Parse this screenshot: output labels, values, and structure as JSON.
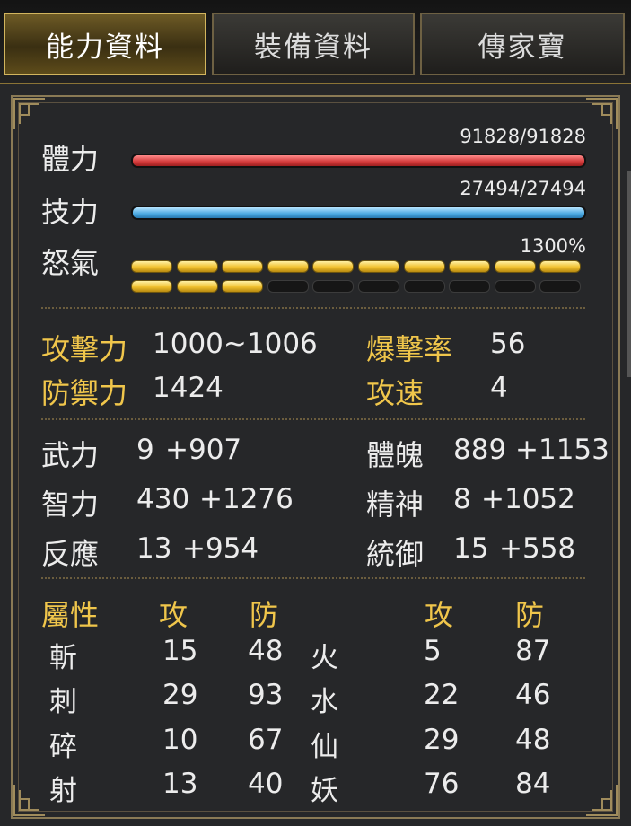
{
  "tabs": [
    "能力資料",
    "裝備資料",
    "傳家寶"
  ],
  "vitals": {
    "hp_label": "體力",
    "hp_value": "91828/91828",
    "hp_fraction": 1.0,
    "sp_label": "技力",
    "sp_value": "27494/27494",
    "sp_fraction": 1.0,
    "rage_label": "怒氣",
    "rage_value": "1300%",
    "rage_filled": 13,
    "rage_total": 20
  },
  "combat": {
    "attack_label": "攻擊力",
    "attack_value": "1000~1006",
    "crit_label": "爆擊率",
    "crit_value": "56",
    "defense_label": "防禦力",
    "defense_value": "1424",
    "speed_label": "攻速",
    "speed_value": "4"
  },
  "stats": [
    {
      "label": "武力",
      "base": "9",
      "bonus": "+907"
    },
    {
      "label": "體魄",
      "base": "889",
      "bonus": "+1153"
    },
    {
      "label": "智力",
      "base": "430",
      "bonus": "+1276"
    },
    {
      "label": "精神",
      "base": "8",
      "bonus": "+1052"
    },
    {
      "label": "反應",
      "base": "13",
      "bonus": "+954"
    },
    {
      "label": "統御",
      "base": "15",
      "bonus": "+558"
    }
  ],
  "attributes": {
    "header_label": "屬性",
    "atk_header": "攻",
    "def_header": "防",
    "left": [
      {
        "name": "斬",
        "atk": "15",
        "def": "48"
      },
      {
        "name": "刺",
        "atk": "29",
        "def": "93"
      },
      {
        "name": "碎",
        "atk": "10",
        "def": "67"
      },
      {
        "name": "射",
        "atk": "13",
        "def": "40"
      }
    ],
    "right": [
      {
        "name": "火",
        "atk": "5",
        "def": "87"
      },
      {
        "name": "水",
        "atk": "22",
        "def": "46"
      },
      {
        "name": "仙",
        "atk": "29",
        "def": "48"
      },
      {
        "name": "妖",
        "atk": "76",
        "def": "84"
      }
    ]
  },
  "colors": {
    "gold_label": "#f0c64b",
    "bonus_green": "#8fd06b",
    "hp_red": "#d23a3a",
    "sp_blue": "#4aa8e0"
  }
}
